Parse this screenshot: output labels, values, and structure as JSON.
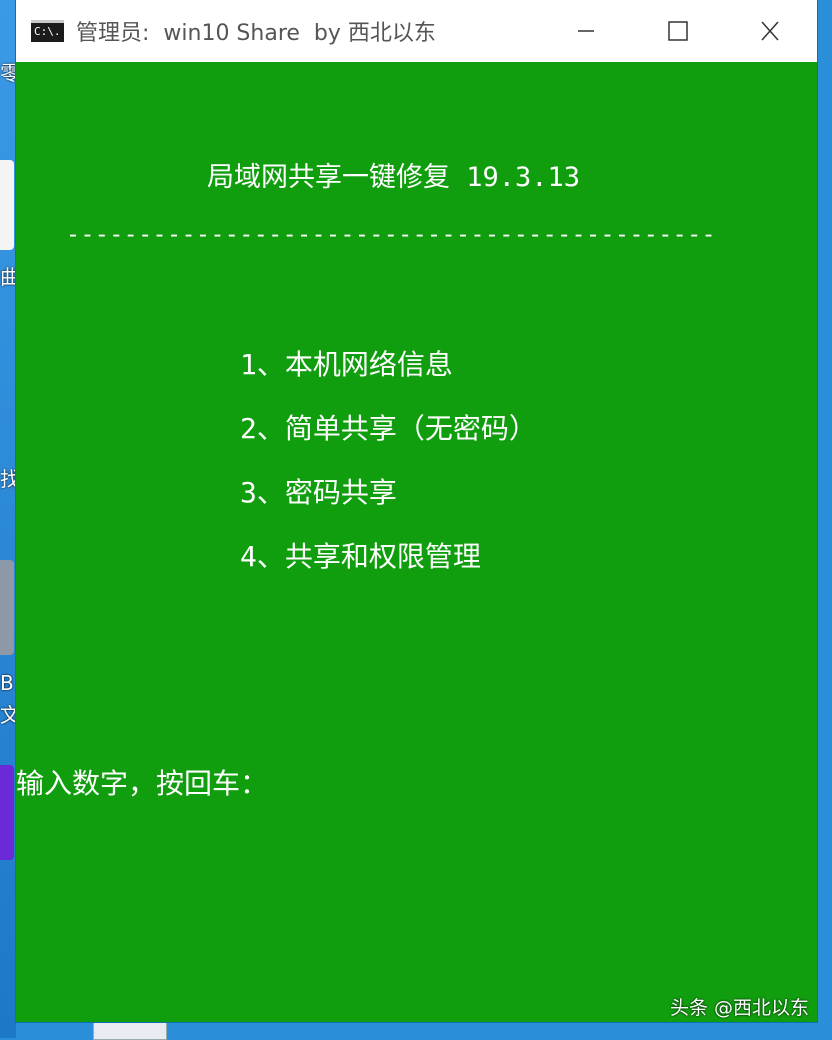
{
  "window": {
    "title": "管理员:  win10 Share  by 西北以东",
    "icon_text": "C:\\.",
    "bg_color": "#109e0e",
    "titlebar_color": "#ffffff"
  },
  "console": {
    "header": "局域网共享一键修复 19.3.13",
    "separator": "---------------------------------------------",
    "menu": [
      {
        "label": "1、本机网络信息"
      },
      {
        "label": "2、简单共享（无密码）"
      },
      {
        "label": "3、密码共享"
      },
      {
        "label": "4、共享和权限管理"
      }
    ],
    "prompt": "输入数字，按回车："
  },
  "desktop": {
    "glyphs": [
      "零",
      "曲",
      "找",
      "B",
      "文"
    ]
  },
  "watermark": "头条 @西北以东"
}
